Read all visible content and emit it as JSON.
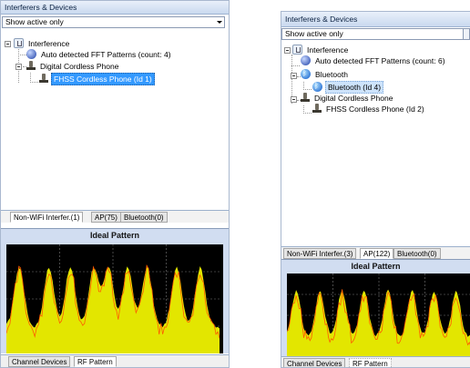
{
  "panel_left": {
    "title": "Interferers & Devices",
    "filter": "Show active only",
    "tree": {
      "root": "Interference",
      "auto_fft": "Auto detected FFT Patterns (count: 4)",
      "cordless_group": "Digital Cordless Phone",
      "cordless_device": "FHSS Cordless Phone (Id 1)"
    },
    "tabs": [
      "Non-WiFi Interfer.(1)",
      "AP(75)",
      "Bluetooth(0)"
    ],
    "pattern_title": "Ideal Pattern",
    "bottom_tabs": [
      "Channel Devices",
      "RF Pattern"
    ]
  },
  "panel_right": {
    "title": "Interferers & Devices",
    "filter": "Show active only",
    "tree": {
      "root": "Interference",
      "auto_fft": "Auto detected FFT Patterns (count: 6)",
      "bluetooth_group": "Bluetooth",
      "bluetooth_device": "Bluetooth (Id 4)",
      "cordless_group": "Digital Cordless Phone",
      "cordless_device": "FHSS Cordless Phone (Id 2)"
    },
    "tabs": [
      "Non-WiFi Interfer.(3)",
      "AP(122)",
      "Bluetooth(0)"
    ],
    "pattern_title": "Ideal Pattern",
    "bottom_tabs": [
      "Channel Devices",
      "RF Pattern"
    ]
  },
  "colors": {
    "selection": "#3399ff",
    "plot_background": "#000000",
    "ideal_fill": "#e3e600",
    "measured_line": "#ff5a00",
    "grid": "#7a7a7a"
  },
  "icons": [
    "interference-icon",
    "fft-pattern-icon",
    "bluetooth-icon",
    "cordless-phone-icon",
    "dropdown-arrow-icon"
  ]
}
